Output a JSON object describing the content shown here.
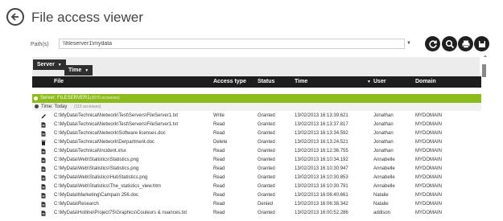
{
  "header": {
    "title": "File access viewer"
  },
  "path": {
    "label": "Path(s)",
    "value": "\\\\fileserver1\\mydata"
  },
  "grouping": {
    "server_chip": "Server",
    "time_chip": "Time"
  },
  "columns": [
    "File",
    "Access type",
    "Status",
    "Time",
    "User",
    "Domain"
  ],
  "server_group": {
    "label": "Server: FILESERVER1",
    "count": "(3070 accesses)"
  },
  "time_group": {
    "label": "Time: Today",
    "count": "(119 accesses)"
  },
  "rows": [
    {
      "icon": "pencil-icon",
      "file": "C:\\MyData\\Technical\\Network\\Test\\Servers\\FileServer1.txt",
      "access": "Write",
      "status": "Granted",
      "time": "13/02/2013 16:13:39.621",
      "user": "Jonathan",
      "domain": "MYDOMAIN"
    },
    {
      "icon": "document-icon",
      "file": "C:\\MyData\\Technical\\Network\\Test\\Servers\\FileServer1.txt",
      "access": "Read",
      "status": "Granted",
      "time": "13/02/2013 16:13:37.817",
      "user": "Jonathan",
      "domain": "MYDOMAIN"
    },
    {
      "icon": "document-icon",
      "file": "C:\\MyData\\Technical\\Network\\Software licenses.doc",
      "access": "Read",
      "status": "Granted",
      "time": "13/02/2013 16:13:34.592",
      "user": "Jonathan",
      "domain": "MYDOMAIN"
    },
    {
      "icon": "trash-icon",
      "file": "C:\\MyData\\Technical\\Network\\Derpartment.doc",
      "access": "Delete",
      "status": "Granted",
      "time": "13/02/2013 16:13:24.521",
      "user": "Jonathan",
      "domain": "MYDOMAIN"
    },
    {
      "icon": "document-icon",
      "file": "C:\\MyData\\Technical\\Incident.xlsx",
      "access": "Read",
      "status": "Granted",
      "time": "13/02/2013 16:12:36.755",
      "user": "Jonathan",
      "domain": "MYDOMAIN"
    },
    {
      "icon": "document-icon",
      "file": "C:\\MyData\\Web\\Statistics\\Statistics.png",
      "access": "Read",
      "status": "Granted",
      "time": "13/02/2013 16:10:34.192",
      "user": "Annabelle",
      "domain": "MYDOMAIN"
    },
    {
      "icon": "document-icon",
      "file": "C:\\MyData\\Web\\Statistics\\Statistics.png",
      "access": "Read",
      "status": "Granted",
      "time": "13/02/2013 16:10:30.947",
      "user": "Annabelle",
      "domain": "MYDOMAIN"
    },
    {
      "icon": "document-icon",
      "file": "C:\\MyData\\Web\\Statistics\\HubStatistics.png",
      "access": "Read",
      "status": "Granted",
      "time": "13/02/2013 16:10:30.853",
      "user": "Annabelle",
      "domain": "MYDOMAIN"
    },
    {
      "icon": "document-icon",
      "file": "C:\\MyData\\Web\\Statistics\\The_statistics_view.htm",
      "access": "Read",
      "status": "Granted",
      "time": "13/02/2013 16:10:30.791",
      "user": "Annabelle",
      "domain": "MYDOMAIN"
    },
    {
      "icon": "document-icon",
      "file": "C:\\MyData\\Marketing\\Campain 256.doc",
      "access": "Read",
      "status": "Granted",
      "time": "13/02/2013 16:06:40.661",
      "user": "Natalie",
      "domain": "MYDOMAIN"
    },
    {
      "icon": "document-icon",
      "file": "C:\\MyData\\Research",
      "access": "Read",
      "status": "Denied",
      "time": "13/02/2013 16:06:38.342",
      "user": "Natalie",
      "domain": "MYDOMAIN"
    },
    {
      "icon": "document-icon",
      "file": "C:\\MyData\\Hotline\\Project75\\Graphics\\Couleurs & nuances.txt",
      "access": "Read",
      "status": "Granted",
      "time": "13/02/2013 16:00:52.286",
      "user": "addison",
      "domain": "MYDOMAIN"
    }
  ],
  "colors": {
    "accent_green": "#8dbb1c",
    "header_dark": "#1e1e1e"
  }
}
